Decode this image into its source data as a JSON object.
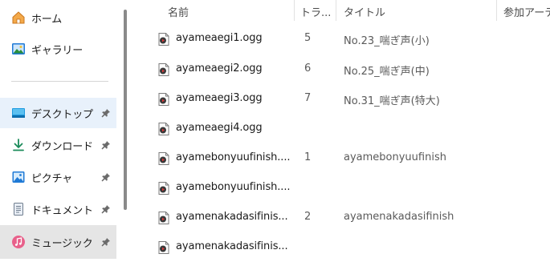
{
  "sidebar": {
    "items": [
      {
        "label": "ホーム",
        "icon": "home-icon",
        "pinned": false
      },
      {
        "label": "ギャラリー",
        "icon": "gallery-icon",
        "pinned": false
      },
      {
        "label": "デスクトップ",
        "icon": "desktop-icon",
        "pinned": true
      },
      {
        "label": "ダウンロード",
        "icon": "download-icon",
        "pinned": true
      },
      {
        "label": "ピクチャ",
        "icon": "pictures-icon",
        "pinned": true
      },
      {
        "label": "ドキュメント",
        "icon": "documents-icon",
        "pinned": true
      },
      {
        "label": "ミュージック",
        "icon": "music-icon",
        "pinned": true
      }
    ]
  },
  "columns": {
    "name": "名前",
    "track": "トラ...",
    "title": "タイトル",
    "artist": "参加アーティ"
  },
  "files": [
    {
      "name": "ayameaegi1.ogg",
      "track": "5",
      "title": "No.23_喘ぎ声(小)"
    },
    {
      "name": "ayameaegi2.ogg",
      "track": "6",
      "title": "No.25_喘ぎ声(中)"
    },
    {
      "name": "ayameaegi3.ogg",
      "track": "7",
      "title": "No.31_喘ぎ声(特大)"
    },
    {
      "name": "ayameaegi4.ogg",
      "track": "",
      "title": ""
    },
    {
      "name": "ayamebonyuufinish....",
      "track": "1",
      "title": "ayamebonyuufinish"
    },
    {
      "name": "ayamebonyuufinish....",
      "track": "",
      "title": ""
    },
    {
      "name": "ayamenakadasifinis...",
      "track": "2",
      "title": "ayamenakadasifinish"
    },
    {
      "name": "ayamenakadasifinis...",
      "track": "",
      "title": ""
    }
  ],
  "colors": {
    "pinned_hover": "#e8f1fb",
    "selected": "#e5e5e5",
    "accent": "#0067c0"
  }
}
